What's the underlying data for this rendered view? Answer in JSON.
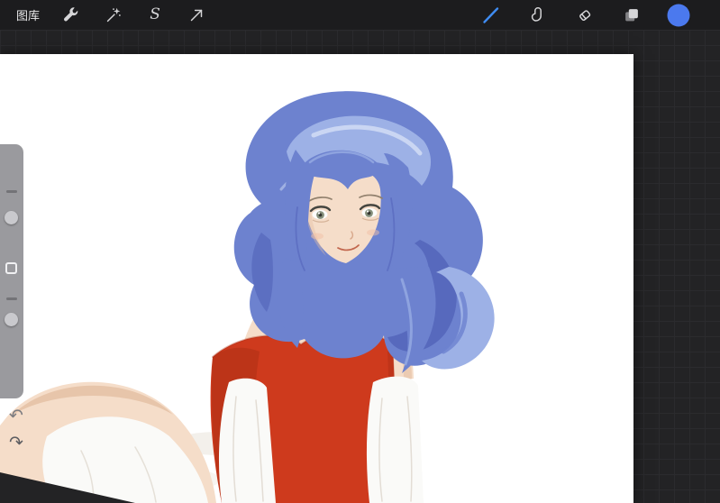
{
  "toolbar": {
    "gallery_label": "图库",
    "selection_glyph": "S",
    "left_tools": [
      {
        "name": "actions",
        "icon": "wrench-icon"
      },
      {
        "name": "adjustments",
        "icon": "magic-wand-icon"
      },
      {
        "name": "selection",
        "icon": "selection-s-icon"
      },
      {
        "name": "transform",
        "icon": "transform-arrow-icon"
      }
    ],
    "right_tools": [
      {
        "name": "paint",
        "icon": "paintbrush-icon",
        "active": true
      },
      {
        "name": "smudge",
        "icon": "smudge-finger-icon",
        "active": false
      },
      {
        "name": "erase",
        "icon": "eraser-icon",
        "active": false
      },
      {
        "name": "layers",
        "icon": "layers-icon",
        "active": false
      },
      {
        "name": "color",
        "icon": "color-swatch",
        "active": false
      }
    ]
  },
  "sidebar": {
    "sliders": [
      {
        "name": "brush-size"
      },
      {
        "name": "opacity"
      }
    ],
    "modify_button": "modify",
    "undo_glyph": "↶",
    "redo_glyph": "↷"
  },
  "canvas": {
    "background": "#ffffff",
    "artwork_description": "Digital painting of a girl with wavy blue hair and gray-green eyes, wearing a red strapless top with white detached sleeves, leaning forward on a white canvas"
  },
  "colors": {
    "accent_blue": "#3f8cf2",
    "swatch_blue": "#4b79ee",
    "icon_gray": "#d6d6d8",
    "topbar_bg": "#1c1c1e",
    "workspace_bg": "#232325",
    "grid_line": "#2b2b2e",
    "sidebar_gray": "#949498",
    "hair_mid": "#6d82cf",
    "hair_dark": "#4c5cb4",
    "hair_light": "#9db1e6",
    "hair_pale": "#d2ddf5",
    "skin": "#f5ddc9",
    "skin_shade": "#e4bfa3",
    "iris_green": "#87917d",
    "top_red": "#ce3a1d",
    "top_red_dark": "#a92d13",
    "fabric_white": "#fafaf8",
    "fabric_shade": "#e0d9d0",
    "soft_shadow": "#eae3da"
  }
}
